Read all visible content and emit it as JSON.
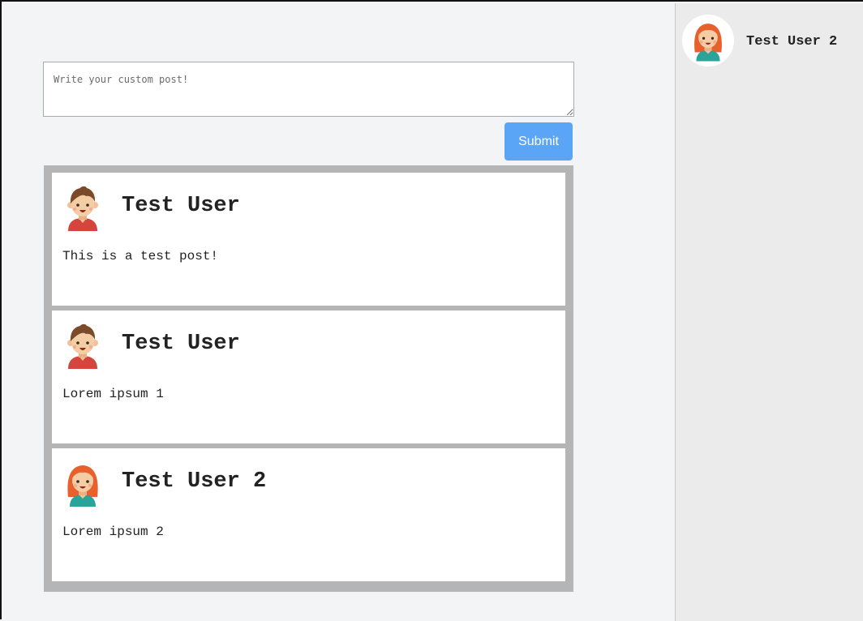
{
  "composer": {
    "placeholder": "Write your custom post!",
    "submit_label": "Submit",
    "submit_color": "#5aa5f5"
  },
  "posts": [
    {
      "author": "Test User",
      "avatar": "boy-avatar-icon",
      "body": "This is a test post!"
    },
    {
      "author": "Test User",
      "avatar": "boy-avatar-icon",
      "body": "Lorem ipsum 1"
    },
    {
      "author": "Test User 2",
      "avatar": "girl-avatar-icon",
      "body": "Lorem ipsum 2"
    }
  ],
  "sidebar": {
    "users": [
      {
        "name": "Test User 2",
        "avatar": "girl-avatar-icon"
      }
    ]
  }
}
